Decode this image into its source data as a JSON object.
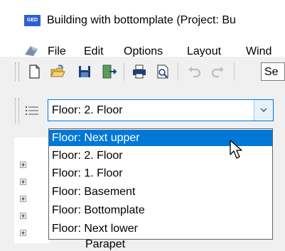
{
  "window": {
    "title": "Building with bottomplate (Project: Bu",
    "icon_label": "GED"
  },
  "menu": {
    "items": [
      "File",
      "Edit",
      "Options",
      "Layout",
      "Wind"
    ]
  },
  "toolbar": {
    "search_text": "Se"
  },
  "floor_selector": {
    "value": "Floor: 2. Floor",
    "options": [
      "Floor: Next upper",
      "Floor: 2. Floor",
      "Floor: 1. Floor",
      "Floor: Basement",
      "Floor: Bottomplate",
      "Floor: Next lower"
    ],
    "highlighted": "Floor: Next upper"
  },
  "tree": {
    "peek_text": "Parapet"
  },
  "colors": {
    "accent": "#0078d7",
    "app_icon": "#2f5fd0"
  }
}
